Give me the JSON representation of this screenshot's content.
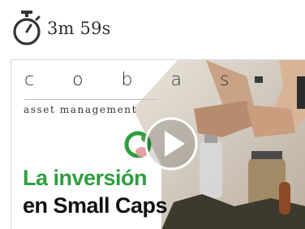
{
  "duration": {
    "text": "3m 59s",
    "icon": "stopwatch-icon"
  },
  "thumbnail": {
    "brand": "c o b a s",
    "tagline": "asset management",
    "headline_line1": "La inversión",
    "headline_line2": "en Small Caps",
    "play_icon": "play-icon",
    "colors": {
      "green": "#2e9e3f",
      "dark": "#111111"
    }
  }
}
